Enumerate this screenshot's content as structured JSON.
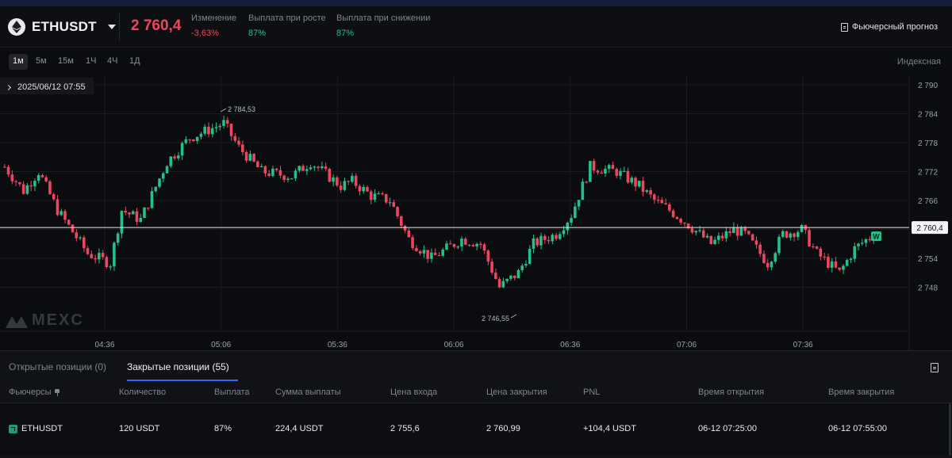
{
  "header": {
    "symbol": "ETHUSDT",
    "price": "2 760,4",
    "stats": [
      {
        "label": "Изменение",
        "value": "-3,63%",
        "color": "red"
      },
      {
        "label": "Выплата при росте",
        "value": "87%",
        "color": "green"
      },
      {
        "label": "Выплата при снижении",
        "value": "87%",
        "color": "green"
      }
    ],
    "forecast_label": "Фьючерсный прогноз"
  },
  "toolbar": {
    "timeframes": [
      "1м",
      "5м",
      "15м",
      "1Ч",
      "4Ч",
      "1Д"
    ],
    "active_timeframe": "1м",
    "price_type": "Индексная"
  },
  "chart": {
    "datetime": "2025/06/12 07:55",
    "y_ticks": [
      "2 790",
      "2 784",
      "2 778",
      "2 772",
      "2 766",
      "2 760",
      "2 754",
      "2 748"
    ],
    "x_ticks": [
      "04:36",
      "05:06",
      "05:36",
      "06:06",
      "06:36",
      "07:06",
      "07:36"
    ],
    "high_label": "2 784,53",
    "low_label": "2 746,55",
    "current_price": "2 760,4",
    "marker": "W",
    "watermark": "MEXC",
    "colors": {
      "up": "#24c28a",
      "down": "#f0455f"
    }
  },
  "panel": {
    "tabs": [
      {
        "label": "Открытые позиции (0)",
        "active": false
      },
      {
        "label": "Закрытые позиции (55)",
        "active": true
      }
    ],
    "columns": [
      "Фьючерсы",
      "Количество",
      "Выплата",
      "Сумма выплаты",
      "Цена входа",
      "Цена закрытия",
      "PNL",
      "Время открытия",
      "Время закрытия"
    ],
    "rows": [
      {
        "symbol": "ETHUSDT",
        "quantity": "120 USDT",
        "payout": "87%",
        "payout_amount": "224,4 USDT",
        "entry_price": "2 755,6",
        "close_price": "2 760,99",
        "pnl": "+104,4 USDT",
        "open_time": "06-12 07:25:00",
        "close_time": "06-12 07:55:00"
      }
    ]
  }
}
